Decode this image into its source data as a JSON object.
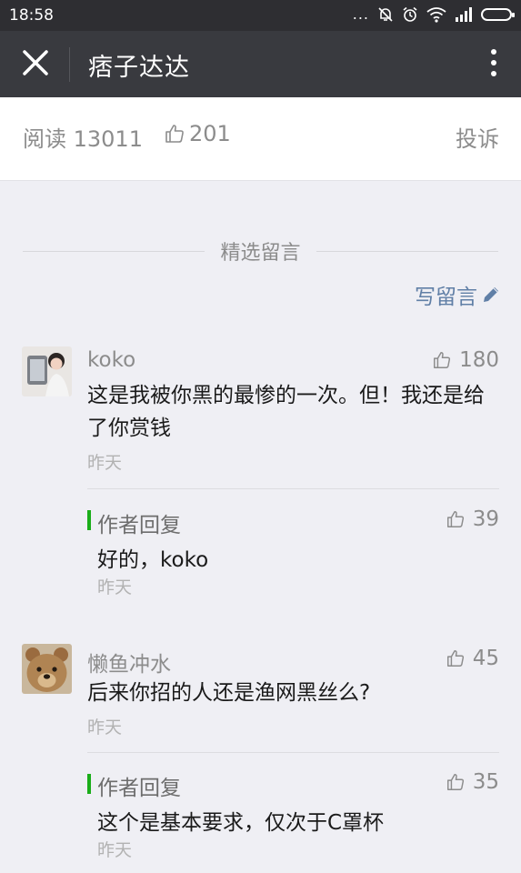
{
  "status_bar": {
    "time": "18:58",
    "dots": "..."
  },
  "nav": {
    "title": "痞子达达"
  },
  "stats": {
    "read": "阅读 13011",
    "likes": "201",
    "report": "投诉"
  },
  "section": {
    "title": "精选留言",
    "write": "写留言"
  },
  "comments": [
    {
      "name": "koko",
      "likes": "180",
      "text": "这是我被你黑的最惨的一次。但！我还是给了你赏钱",
      "time": "昨天",
      "reply": {
        "label": "作者回复",
        "likes": "39",
        "text": "好的，koko",
        "time": "昨天"
      }
    },
    {
      "name": "懒鱼冲水",
      "likes": "45",
      "text": "后来你招的人还是渔网黑丝么?",
      "time": "昨天",
      "reply": {
        "label": "作者回复",
        "likes": "35",
        "text": "这个是基本要求，仅次于C罩杯",
        "time": "昨天"
      }
    }
  ],
  "colors": {
    "accent_link": "#607fa6",
    "reply_bar": "#1aad19",
    "nav_bg": "#393a3f"
  }
}
